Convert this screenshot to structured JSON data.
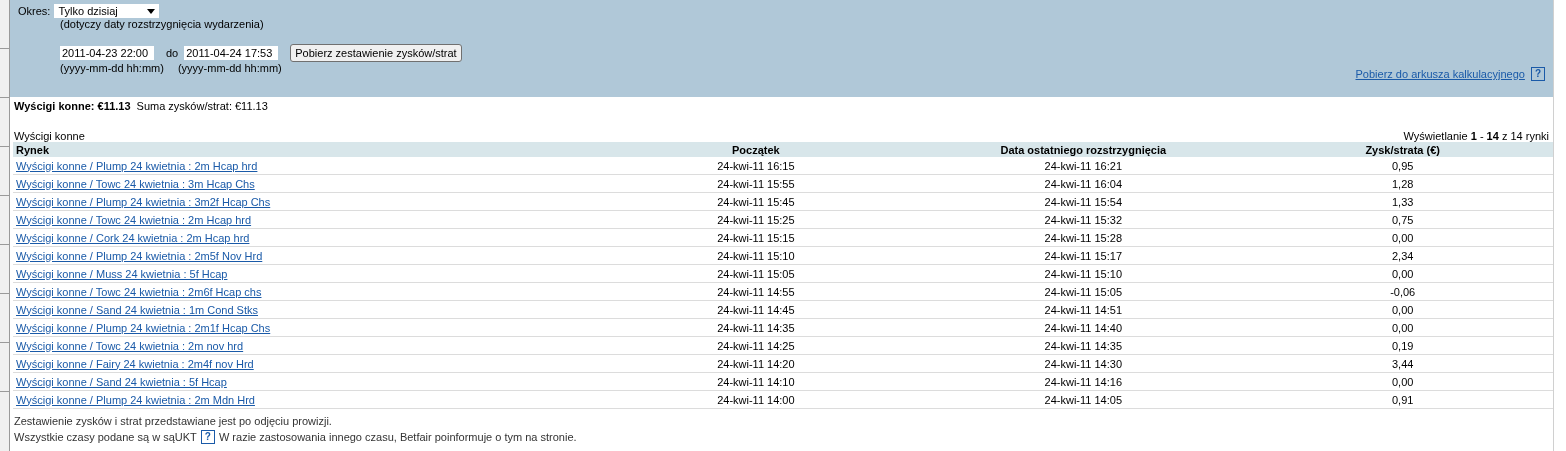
{
  "filter": {
    "period_label": "Okres:",
    "period_value": "Tylko dzisiaj",
    "period_note": "(dotyczy daty rozstrzygnięcia wydarzenia)",
    "from_value": "2011-04-23 22:00",
    "to_label": "do",
    "to_value": "2011-04-24 17:53",
    "from_hint": "(yyyy-mm-dd hh:mm)",
    "to_hint": "(yyyy-mm-dd hh:mm)",
    "submit": "Pobierz zestawienie zysków/strat",
    "export_link": "Pobierz do arkusza kalkulacyjnego",
    "help": "?"
  },
  "summary": {
    "title": "Wyścigi konne: €11.13",
    "total": "Suma zysków/strat:  €11.13"
  },
  "section": {
    "title": "Wyścigi konne",
    "paging": "Wyświetlanie **1** - **14** z 14 rynki"
  },
  "table": {
    "columns": [
      "Rynek",
      "Początek",
      "Data ostatniego rozstrzygnięcia",
      "Zysk/strata (€)"
    ],
    "rows": [
      [
        "Wyścigi konne / Plump 24 kwietnia : 2m Hcap hrd",
        "24-kwi-11 16:15",
        "24-kwi-11 16:21",
        "0,95"
      ],
      [
        "Wyścigi konne / Towc 24 kwietnia : 3m Hcap Chs",
        "24-kwi-11 15:55",
        "24-kwi-11 16:04",
        "1,28"
      ],
      [
        "Wyścigi konne / Plump 24 kwietnia : 3m2f Hcap Chs",
        "24-kwi-11 15:45",
        "24-kwi-11 15:54",
        "1,33"
      ],
      [
        "Wyścigi konne / Towc 24 kwietnia : 2m Hcap hrd",
        "24-kwi-11 15:25",
        "24-kwi-11 15:32",
        "0,75"
      ],
      [
        "Wyścigi konne / Cork 24 kwietnia : 2m Hcap hrd",
        "24-kwi-11 15:15",
        "24-kwi-11 15:28",
        "0,00"
      ],
      [
        "Wyścigi konne / Plump 24 kwietnia : 2m5f Nov Hrd",
        "24-kwi-11 15:10",
        "24-kwi-11 15:17",
        "2,34"
      ],
      [
        "Wyścigi konne / Muss 24 kwietnia : 5f Hcap",
        "24-kwi-11 15:05",
        "24-kwi-11 15:10",
        "0,00"
      ],
      [
        "Wyścigi konne / Towc 24 kwietnia : 2m6f Hcap chs",
        "24-kwi-11 14:55",
        "24-kwi-11 15:05",
        "-0,06"
      ],
      [
        "Wyścigi konne / Sand 24 kwietnia : 1m Cond Stks",
        "24-kwi-11 14:45",
        "24-kwi-11 14:51",
        "0,00"
      ],
      [
        "Wyścigi konne / Plump 24 kwietnia : 2m1f Hcap Chs",
        "24-kwi-11 14:35",
        "24-kwi-11 14:40",
        "0,00"
      ],
      [
        "Wyścigi konne / Towc 24 kwietnia : 2m nov hrd",
        "24-kwi-11 14:25",
        "24-kwi-11 14:35",
        "0,19"
      ],
      [
        "Wyścigi konne / Fairy 24 kwietnia : 2m4f nov Hrd",
        "24-kwi-11 14:20",
        "24-kwi-11 14:30",
        "3,44"
      ],
      [
        "Wyścigi konne / Sand 24 kwietnia : 5f Hcap",
        "24-kwi-11 14:10",
        "24-kwi-11 14:16",
        "0,00"
      ],
      [
        "Wyścigi konne / Plump 24 kwietnia : 2m Mdn Hrd",
        "24-kwi-11 14:00",
        "24-kwi-11 14:05",
        "0,91"
      ]
    ]
  },
  "footer": {
    "note": "Zestawienie zysków i strat przedstawiane jest po odjęciu prowizji.",
    "time_prefix": "Wszystkie czasy podane są w sąUKT",
    "help": "?",
    "time_suffix": "W razie zastosowania innego czasu, Betfair poinformuje o tym na stronie."
  }
}
